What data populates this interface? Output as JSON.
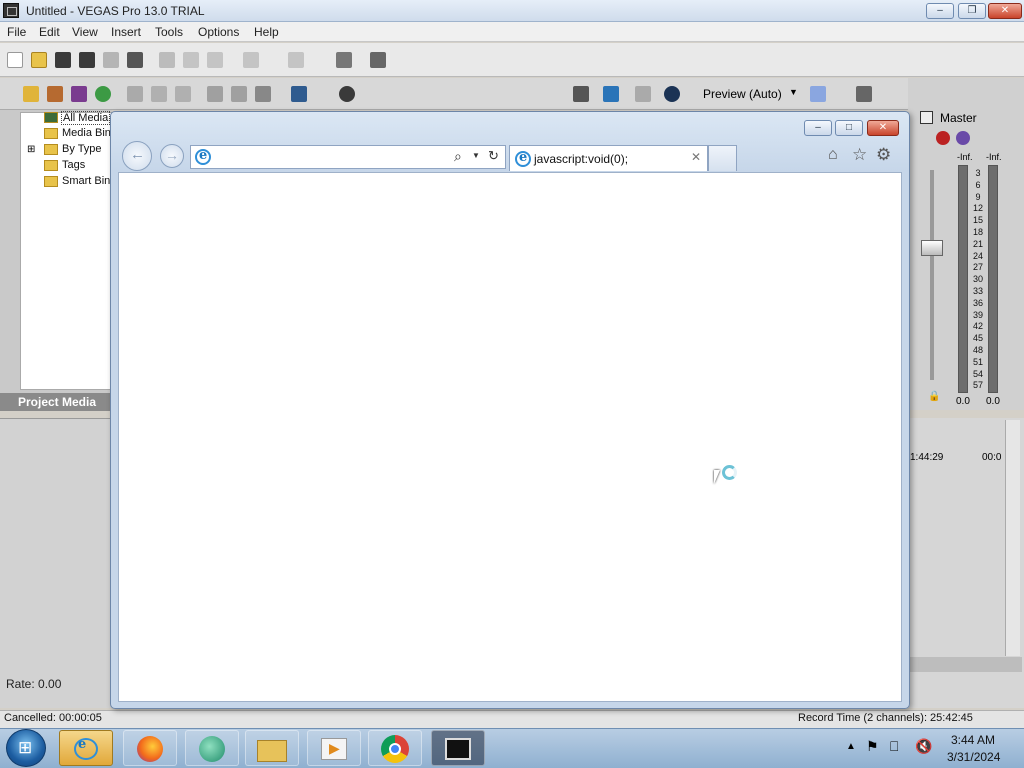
{
  "window": {
    "title": "Untitled - VEGAS Pro 13.0 TRIAL"
  },
  "menu": [
    "File",
    "Edit",
    "View",
    "Insert",
    "Tools",
    "Options",
    "Help"
  ],
  "preview": {
    "label": "Preview (Auto)"
  },
  "project_media": {
    "tree": [
      "All Media",
      "Media Bins",
      "By Type",
      "Tags",
      "Smart Bins"
    ],
    "label": "Project Media"
  },
  "master": {
    "label": "Master",
    "left_peak": "-Inf.",
    "right_peak": "-Inf.",
    "scale": [
      "3",
      "6",
      "9",
      "12",
      "15",
      "18",
      "21",
      "24",
      "27",
      "30",
      "33",
      "36",
      "39",
      "42",
      "45",
      "48",
      "51",
      "54",
      "57"
    ],
    "left_value": "0.0",
    "right_value": "0.0"
  },
  "timeline": {
    "time_left": "1:44:29",
    "time_right": "00:0"
  },
  "rate": "Rate: 0.00",
  "status": {
    "left": "Cancelled: 00:00:05",
    "right": "Record Time (2 channels): 25:42:45"
  },
  "browser": {
    "address": "",
    "tab_title": "javascript:void(0);"
  },
  "clock": {
    "time": "3:44 AM",
    "date": "3/31/2024"
  },
  "colors": {
    "titlebar": "#cfdcec",
    "ie_blue": "#1a78c2",
    "close_red": "#c9442b"
  }
}
